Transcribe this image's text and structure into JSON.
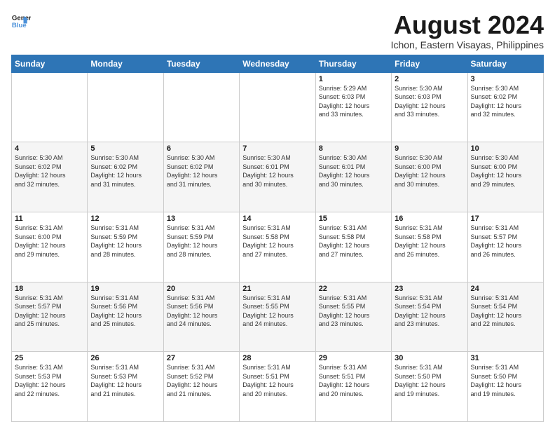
{
  "logo": {
    "line1": "General",
    "line2": "Blue"
  },
  "title": "August 2024",
  "subtitle": "Ichon, Eastern Visayas, Philippines",
  "days_of_week": [
    "Sunday",
    "Monday",
    "Tuesday",
    "Wednesday",
    "Thursday",
    "Friday",
    "Saturday"
  ],
  "weeks": [
    [
      {
        "day": "",
        "info": ""
      },
      {
        "day": "",
        "info": ""
      },
      {
        "day": "",
        "info": ""
      },
      {
        "day": "",
        "info": ""
      },
      {
        "day": "1",
        "info": "Sunrise: 5:29 AM\nSunset: 6:03 PM\nDaylight: 12 hours\nand 33 minutes."
      },
      {
        "day": "2",
        "info": "Sunrise: 5:30 AM\nSunset: 6:03 PM\nDaylight: 12 hours\nand 33 minutes."
      },
      {
        "day": "3",
        "info": "Sunrise: 5:30 AM\nSunset: 6:02 PM\nDaylight: 12 hours\nand 32 minutes."
      }
    ],
    [
      {
        "day": "4",
        "info": "Sunrise: 5:30 AM\nSunset: 6:02 PM\nDaylight: 12 hours\nand 32 minutes."
      },
      {
        "day": "5",
        "info": "Sunrise: 5:30 AM\nSunset: 6:02 PM\nDaylight: 12 hours\nand 31 minutes."
      },
      {
        "day": "6",
        "info": "Sunrise: 5:30 AM\nSunset: 6:02 PM\nDaylight: 12 hours\nand 31 minutes."
      },
      {
        "day": "7",
        "info": "Sunrise: 5:30 AM\nSunset: 6:01 PM\nDaylight: 12 hours\nand 30 minutes."
      },
      {
        "day": "8",
        "info": "Sunrise: 5:30 AM\nSunset: 6:01 PM\nDaylight: 12 hours\nand 30 minutes."
      },
      {
        "day": "9",
        "info": "Sunrise: 5:30 AM\nSunset: 6:00 PM\nDaylight: 12 hours\nand 30 minutes."
      },
      {
        "day": "10",
        "info": "Sunrise: 5:30 AM\nSunset: 6:00 PM\nDaylight: 12 hours\nand 29 minutes."
      }
    ],
    [
      {
        "day": "11",
        "info": "Sunrise: 5:31 AM\nSunset: 6:00 PM\nDaylight: 12 hours\nand 29 minutes."
      },
      {
        "day": "12",
        "info": "Sunrise: 5:31 AM\nSunset: 5:59 PM\nDaylight: 12 hours\nand 28 minutes."
      },
      {
        "day": "13",
        "info": "Sunrise: 5:31 AM\nSunset: 5:59 PM\nDaylight: 12 hours\nand 28 minutes."
      },
      {
        "day": "14",
        "info": "Sunrise: 5:31 AM\nSunset: 5:58 PM\nDaylight: 12 hours\nand 27 minutes."
      },
      {
        "day": "15",
        "info": "Sunrise: 5:31 AM\nSunset: 5:58 PM\nDaylight: 12 hours\nand 27 minutes."
      },
      {
        "day": "16",
        "info": "Sunrise: 5:31 AM\nSunset: 5:58 PM\nDaylight: 12 hours\nand 26 minutes."
      },
      {
        "day": "17",
        "info": "Sunrise: 5:31 AM\nSunset: 5:57 PM\nDaylight: 12 hours\nand 26 minutes."
      }
    ],
    [
      {
        "day": "18",
        "info": "Sunrise: 5:31 AM\nSunset: 5:57 PM\nDaylight: 12 hours\nand 25 minutes."
      },
      {
        "day": "19",
        "info": "Sunrise: 5:31 AM\nSunset: 5:56 PM\nDaylight: 12 hours\nand 25 minutes."
      },
      {
        "day": "20",
        "info": "Sunrise: 5:31 AM\nSunset: 5:56 PM\nDaylight: 12 hours\nand 24 minutes."
      },
      {
        "day": "21",
        "info": "Sunrise: 5:31 AM\nSunset: 5:55 PM\nDaylight: 12 hours\nand 24 minutes."
      },
      {
        "day": "22",
        "info": "Sunrise: 5:31 AM\nSunset: 5:55 PM\nDaylight: 12 hours\nand 23 minutes."
      },
      {
        "day": "23",
        "info": "Sunrise: 5:31 AM\nSunset: 5:54 PM\nDaylight: 12 hours\nand 23 minutes."
      },
      {
        "day": "24",
        "info": "Sunrise: 5:31 AM\nSunset: 5:54 PM\nDaylight: 12 hours\nand 22 minutes."
      }
    ],
    [
      {
        "day": "25",
        "info": "Sunrise: 5:31 AM\nSunset: 5:53 PM\nDaylight: 12 hours\nand 22 minutes."
      },
      {
        "day": "26",
        "info": "Sunrise: 5:31 AM\nSunset: 5:53 PM\nDaylight: 12 hours\nand 21 minutes."
      },
      {
        "day": "27",
        "info": "Sunrise: 5:31 AM\nSunset: 5:52 PM\nDaylight: 12 hours\nand 21 minutes."
      },
      {
        "day": "28",
        "info": "Sunrise: 5:31 AM\nSunset: 5:51 PM\nDaylight: 12 hours\nand 20 minutes."
      },
      {
        "day": "29",
        "info": "Sunrise: 5:31 AM\nSunset: 5:51 PM\nDaylight: 12 hours\nand 20 minutes."
      },
      {
        "day": "30",
        "info": "Sunrise: 5:31 AM\nSunset: 5:50 PM\nDaylight: 12 hours\nand 19 minutes."
      },
      {
        "day": "31",
        "info": "Sunrise: 5:31 AM\nSunset: 5:50 PM\nDaylight: 12 hours\nand 19 minutes."
      }
    ]
  ]
}
